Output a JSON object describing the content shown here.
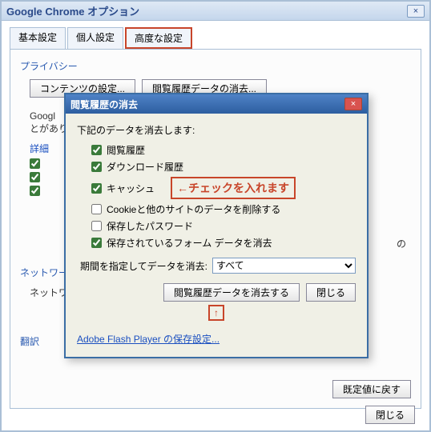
{
  "window": {
    "title": "Google Chrome オプション",
    "close": "×"
  },
  "tabs": {
    "basic": "基本設定",
    "personal": "個人設定",
    "advanced": "高度な設定"
  },
  "sections": {
    "privacy": "プライバシー",
    "network": "ネットワーク",
    "network_sub": "ネットワ",
    "translate": "翻訳"
  },
  "buttons": {
    "content_settings": "コンテンツの設定...",
    "clear_browsing_top": "閲覧履歴データの消去...",
    "reset_default": "既定値に戻す",
    "main_close": "閉じる"
  },
  "dialog": {
    "title": "閲覧履歴の消去",
    "close": "×",
    "instr": "下記のデータを消去します:",
    "checkboxes": {
      "history": "閲覧履歴",
      "downloads": "ダウンロード履歴",
      "cache": "キャッシュ",
      "cookies": "Cookieと他のサイトのデータを削除する",
      "passwords": "保存したパスワード",
      "formdata": "保存されているフォーム データを消去"
    },
    "annotation": "←チェックを入れます",
    "period_label": "期間を指定してデータを消去:",
    "period_value": "すべて",
    "clear_btn": "閲覧履歴データを消去する",
    "close_btn": "閉じる",
    "arrow": "↑",
    "flash_link": "Adobe Flash Player の保存設定..."
  },
  "peek": {
    "goo": "Googl",
    "toga": "とがあり",
    "detail": "詳細",
    "no": "の"
  }
}
